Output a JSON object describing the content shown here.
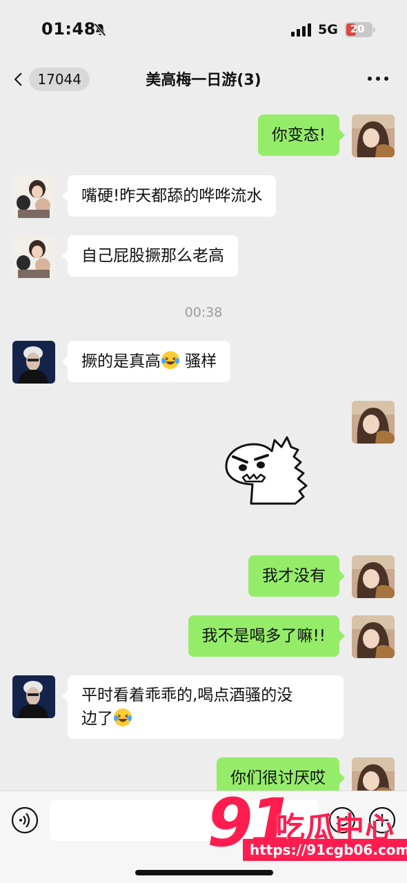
{
  "status_bar": {
    "time": "01:48",
    "network": "5G",
    "battery": "20"
  },
  "header": {
    "unread_badge": "17044",
    "title": "美高梅一日游(3)"
  },
  "messages": [
    {
      "side": "out",
      "text": "你变态!"
    },
    {
      "side": "in",
      "text": "嘴硬!昨天都舔的哗哗流水"
    },
    {
      "side": "in",
      "text": "自己屁股撅那么老高"
    },
    {
      "side": "in",
      "text_before": "撅的是真高",
      "text_after": " 骚样",
      "emoji": "laughing-crying-emoji"
    },
    {
      "side": "out",
      "sticker": "angry-dinosaur-sticker"
    },
    {
      "side": "out",
      "text": "我才没有"
    },
    {
      "side": "out",
      "text": "我不是喝多了嘛!!"
    },
    {
      "side": "in",
      "line1": "平时看着乖乖的,喝点酒骚的没",
      "line2": "边了",
      "emoji": "laughing-crying-emoji"
    },
    {
      "side": "out",
      "text": "你们很讨厌哎"
    }
  ],
  "timestamp": "00:38",
  "watermark": {
    "number": "91",
    "name": "吃瓜中心",
    "url": "https://91cgb06.com"
  },
  "colors": {
    "out_bubble": "#95ec69",
    "in_bubble": "#ffffff",
    "background": "#ededed",
    "watermark": "#ff1d4f"
  }
}
